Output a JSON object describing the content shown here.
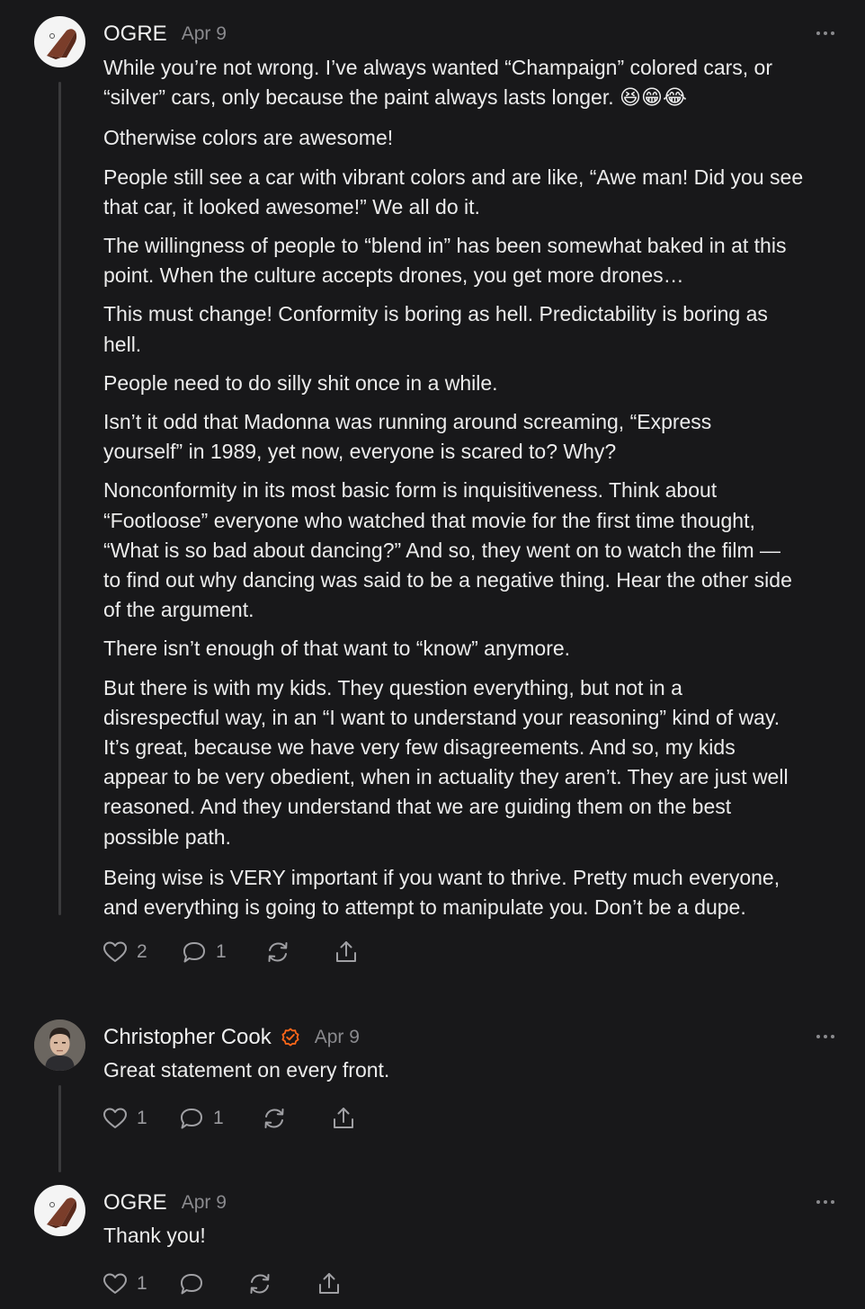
{
  "comments": [
    {
      "author": "OGRE",
      "date": "Apr 9",
      "paragraphs": [
        "While you’re not wrong. I’ve always wanted “Champaign” colored cars, or\n“silver” cars, only because the paint always lasts longer. 😆😁😂",
        "Otherwise colors are awesome!",
        "People still see a car with vibrant colors and are like, “Awe man! Did you see\nthat car, it looked awesome!” We all do it.",
        "The willingness of people to “blend in” has been somewhat baked in at this\npoint. When the culture accepts drones, you get more drones…",
        "This must change! Conformity is boring as hell. Predictability is boring as\nhell.",
        "People need to do silly shit once in a while.",
        "Isn’t it odd that Madonna was running around screaming, “Express\nyourself” in 1989, yet now, everyone is scared to? Why?",
        "Nonconformity in its most basic form is inquisitiveness. Think about\n“Footloose” everyone who watched that movie for the first time thought,\n“What is so bad about dancing?” And so, they went on to watch the film —\nto find out why dancing was said to be a negative thing. Hear the other side\nof the argument.",
        "There isn’t enough of that want to “know” anymore.",
        "But there is with my kids. They question everything, but not in a\ndisrespectful way, in an “I want to understand your reasoning” kind of way.\nIt’s great, because we have very few disagreements. And so, my kids\nappear to be very obedient, when in actuality they aren’t. They are just well\nreasoned. And they understand that we are guiding them on the best\npossible path.",
        "Being wise is VERY important if you want to thrive. Pretty much everyone,\nand everything is going to attempt to manipulate you. Don’t be a dupe."
      ],
      "likes": "2",
      "replies": "1"
    },
    {
      "author": "Christopher Cook",
      "date": "Apr 9",
      "paragraphs": [
        "Great statement on every front."
      ],
      "likes": "1",
      "replies": "1"
    },
    {
      "author": "OGRE",
      "date": "Apr 9",
      "paragraphs": [
        "Thank you!"
      ],
      "likes": "1",
      "replies": ""
    }
  ],
  "icons": {
    "like": "heart-icon",
    "reply": "speech-bubble-icon",
    "restack": "restack-arrows-icon",
    "share": "share-upload-icon",
    "more": "ellipsis-icon",
    "verified": "verified-check-icon"
  },
  "colors": {
    "background": "#18181a",
    "text": "#ececec",
    "muted": "#8a8a8e",
    "verified": "#ff6719",
    "thread_line": "#3a3a3c"
  }
}
